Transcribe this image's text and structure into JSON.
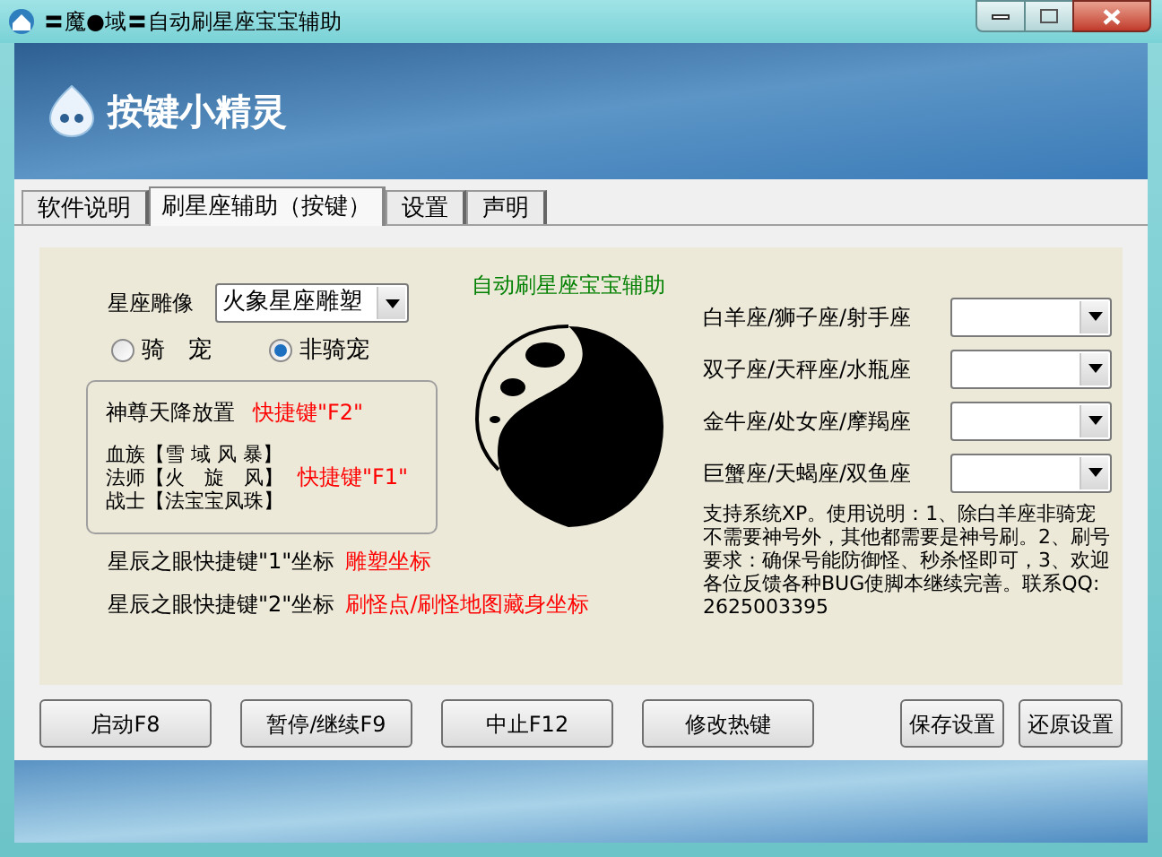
{
  "window": {
    "title": "〓魔●域〓自动刷星座宝宝辅助"
  },
  "banner": {
    "logo_text": "按键小精灵"
  },
  "tabs": [
    {
      "label": "软件说明",
      "selected": false
    },
    {
      "label": "刷星座辅助（按键）",
      "selected": true
    },
    {
      "label": "设置",
      "selected": false
    },
    {
      "label": "声明",
      "selected": false
    }
  ],
  "left": {
    "statue_label": "星座雕像",
    "statue_value": "火象星座雕塑",
    "radios": [
      {
        "label": "骑　宠",
        "selected": false
      },
      {
        "label": "非骑宠",
        "selected": true
      }
    ],
    "group": {
      "place_label": "神尊天降放置",
      "place_hotkey": "快捷键\"F2\"",
      "skills": [
        "血族【雪 域 风 暴】",
        "法师【火　旋　风】",
        "战士【法宝宝凤珠】"
      ],
      "skills_hotkey": "快捷键\"F1\""
    },
    "coords": [
      {
        "label": "星辰之眼快捷键\"1\"坐标",
        "hint": "雕塑坐标"
      },
      {
        "label": "星辰之眼快捷键\"2\"坐标",
        "hint": "刷怪点/刷怪地图藏身坐标"
      }
    ]
  },
  "center_title": "自动刷星座宝宝辅助",
  "zodiac": [
    {
      "label": "白羊座/狮子座/射手座"
    },
    {
      "label": "双子座/天秤座/水瓶座"
    },
    {
      "label": "金牛座/处女座/摩羯座"
    },
    {
      "label": "巨蟹座/天蝎座/双鱼座"
    }
  ],
  "description": "支持系统XP。使用说明：1、除白羊座非骑宠不需要神号外，其他都需要是神号刷。2、刷号要求：确保号能防御怪、秒杀怪即可，3、欢迎各位反馈各种BUG使脚本继续完善。联系QQ:2625003395",
  "buttons_left": [
    "启动F8",
    "暂停/继续F9",
    "中止F12",
    "修改热键"
  ],
  "buttons_right": [
    "保存设置",
    "还原设置"
  ]
}
